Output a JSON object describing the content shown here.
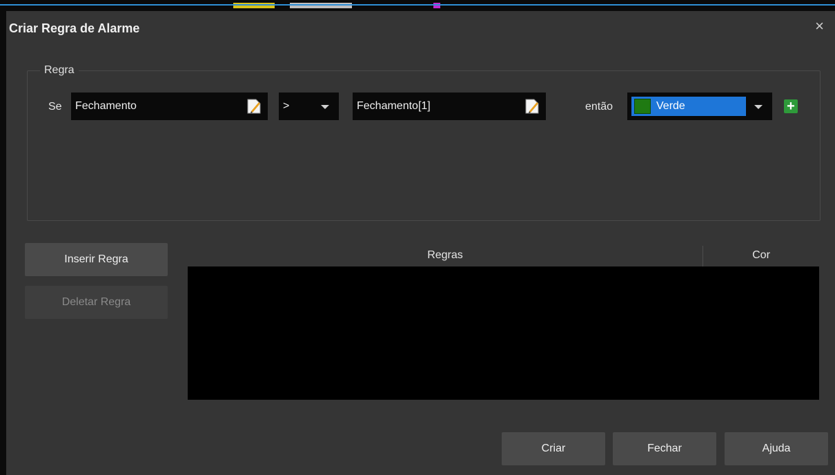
{
  "dialog": {
    "title": "Criar Regra de Alarme",
    "close_glyph": "×"
  },
  "rule_group": {
    "legend": "Regra",
    "if_label": "Se",
    "left_operand": "Fechamento",
    "operator": ">",
    "right_operand": "Fechamento[1]",
    "then_label": "então",
    "color_value": "Verde",
    "color_swatch": "#1f7a12",
    "add_glyph": "+"
  },
  "side_buttons": {
    "insert": "Inserir Regra",
    "delete": "Deletar Regra"
  },
  "rules_table": {
    "columns": [
      "Regras",
      "Cor"
    ],
    "rows": []
  },
  "footer_buttons": {
    "create": "Criar",
    "close": "Fechar",
    "help": "Ajuda"
  },
  "icons": {
    "edit": "edit-icon",
    "dropdown": "chevron-down-icon",
    "add": "plus-icon",
    "close": "close-icon"
  },
  "colors": {
    "dialog_bg": "#353535",
    "field_bg": "#0a0a0a",
    "selection": "#1e76d8",
    "add_green": "#2e9a3a"
  }
}
